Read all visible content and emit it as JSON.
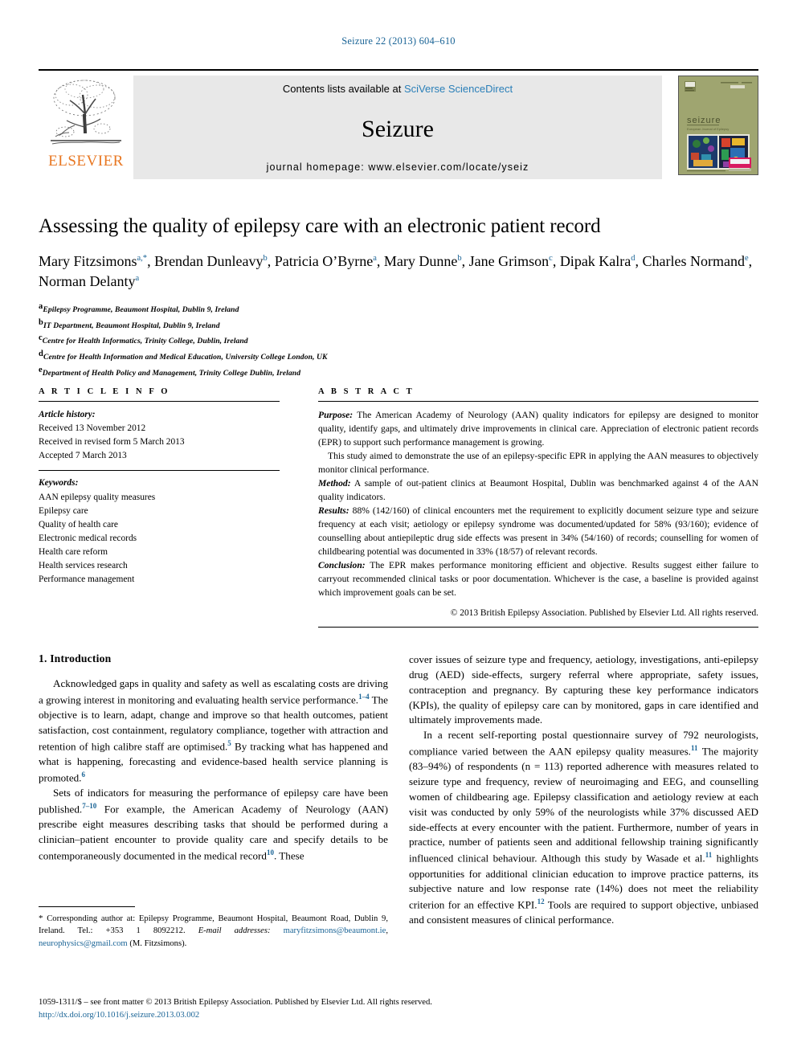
{
  "running_head": "Seizure 22 (2013) 604–610",
  "masthead": {
    "publisher_logo_name": "elsevier-tree-logo",
    "publisher_wordmark": "ELSEVIER",
    "contents_prefix": "Contents lists available at ",
    "contents_link": "SciVerse ScienceDirect",
    "journal_title": "Seizure",
    "homepage": "journal homepage: www.elsevier.com/locate/yseiz",
    "cover_alt": "journal-cover-thumbnail"
  },
  "article": {
    "title": "Assessing the quality of epilepsy care with an electronic patient record",
    "authors": [
      {
        "name": "Mary Fitzsimons",
        "marks": "a,*"
      },
      {
        "name": "Brendan Dunleavy",
        "marks": "b"
      },
      {
        "name": "Patricia O’Byrne",
        "marks": "a"
      },
      {
        "name": "Mary Dunne",
        "marks": "b"
      },
      {
        "name": "Jane Grimson",
        "marks": "c"
      },
      {
        "name": "Dipak Kalra",
        "marks": "d"
      },
      {
        "name": "Charles Normand",
        "marks": "e"
      },
      {
        "name": "Norman Delanty",
        "marks": "a"
      }
    ],
    "affiliations": [
      {
        "mark": "a",
        "text": "Epilepsy Programme, Beaumont Hospital, Dublin 9, Ireland"
      },
      {
        "mark": "b",
        "text": "IT Department, Beaumont Hospital, Dublin 9, Ireland"
      },
      {
        "mark": "c",
        "text": "Centre for Health Informatics, Trinity College, Dublin, Ireland"
      },
      {
        "mark": "d",
        "text": "Centre for Health Information and Medical Education, University College London, UK"
      },
      {
        "mark": "e",
        "text": "Department of Health Policy and Management, Trinity College Dublin, Ireland"
      }
    ]
  },
  "article_info": {
    "heading": "A R T I C L E   I N F O",
    "history_label": "Article history:",
    "history": [
      "Received 13 November 2012",
      "Received in revised form 5 March 2013",
      "Accepted 7 March 2013"
    ],
    "keywords_label": "Keywords:",
    "keywords": [
      "AAN epilepsy quality measures",
      "Epilepsy care",
      "Quality of health care",
      "Electronic medical records",
      "Health care reform",
      "Health services research",
      "Performance management"
    ]
  },
  "abstract": {
    "heading": "A B S T R A C T",
    "purpose_label": "Purpose:",
    "purpose_text": " The American Academy of Neurology (AAN) quality indicators for epilepsy are designed to monitor quality, identify gaps, and ultimately drive improvements in clinical care. Appreciation of electronic patient records (EPR) to support such performance management is growing.",
    "purpose_second": "This study aimed to demonstrate the use of an epilepsy-specific EPR in applying the AAN measures to objectively monitor clinical performance.",
    "method_label": "Method:",
    "method_text": " A sample of out-patient clinics at Beaumont Hospital, Dublin was benchmarked against 4 of the AAN quality indicators.",
    "results_label": "Results:",
    "results_text": " 88% (142/160) of clinical encounters met the requirement to explicitly document seizure type and seizure frequency at each visit; aetiology or epilepsy syndrome was documented/updated for 58% (93/160); evidence of counselling about antiepileptic drug side effects was present in 34% (54/160) of records; counselling for women of childbearing potential was documented in 33% (18/57) of relevant records.",
    "conclusion_label": "Conclusion:",
    "conclusion_text": " The EPR makes performance monitoring efficient and objective. Results suggest either failure to carryout recommended clinical tasks or poor documentation. Whichever is the case, a baseline is provided against which improvement goals can be set.",
    "copyright": "© 2013 British Epilepsy Association. Published by Elsevier Ltd. All rights reserved."
  },
  "body": {
    "section_heading": "1. Introduction",
    "left_p1_a": "Acknowledged gaps in quality and safety as well as escalating costs are driving a growing interest in monitoring and evaluating health service performance.",
    "left_p1_ref1": "1–4",
    "left_p1_b": " The objective is to learn, adapt, change and improve so that health outcomes, patient satisfaction, cost containment, regulatory compliance, together with attraction and retention of high calibre staff are optimised.",
    "left_p1_ref2": "5",
    "left_p1_c": " By tracking what has happened and what is happening, forecasting and evidence-based health service planning is promoted.",
    "left_p1_ref3": "6",
    "left_p2_a": "Sets of indicators for measuring the performance of epilepsy care have been published.",
    "left_p2_ref1": "7–10",
    "left_p2_b": " For example, the American Academy of Neurology (AAN) prescribe eight measures describing tasks that should be performed during a clinician–patient encounter to provide quality care and specify details to be contemporaneously documented in the medical record",
    "left_p2_ref2": "10",
    "left_p2_c": ". These",
    "right_p1": "cover issues of seizure type and frequency, aetiology, investigations, anti-epilepsy drug (AED) side-effects, surgery referral where appropriate, safety issues, contraception and pregnancy. By capturing these key performance indicators (KPIs), the quality of epilepsy care can by monitored, gaps in care identified and ultimately improvements made.",
    "right_p2_a": "In a recent self-reporting postal questionnaire survey of 792 neurologists, compliance varied between the AAN epilepsy quality measures.",
    "right_p2_ref1": "11",
    "right_p2_b": " The majority (83–94%) of respondents (n = 113) reported adherence with measures related to seizure type and frequency, review of neuroimaging and EEG, and counselling women of childbearing age. Epilepsy classification and aetiology review at each visit was conducted by only 59% of the neurologists while 37% discussed AED side-effects at every encounter with the patient. Furthermore, number of years in practice, number of patients seen and additional fellowship training significantly influenced clinical behaviour. Although this study by Wasade et al.",
    "right_p2_ref2": "11",
    "right_p2_c": " highlights opportunities for additional clinician education to improve practice patterns, its subjective nature and low response rate (14%) does not meet the reliability criterion for an effective KPI.",
    "right_p2_ref3": "12",
    "right_p2_d": " Tools are required to support objective, unbiased and consistent measures of clinical performance."
  },
  "footnote": {
    "star": "*",
    "corresponding": " Corresponding author at: Epilepsy Programme, Beaumont Hospital, Beaumont Road, Dublin 9, Ireland. Tel.: +353 1 8092212.",
    "email_label": "E-mail addresses:",
    "email1": "maryfitzsimons@beaumont.ie",
    "email_sep": ", ",
    "email2": "neurophysics@gmail.com",
    "email_suffix": "(M. Fitzsimons)."
  },
  "page_footer": {
    "issn_line": "1059-1311/$ – see front matter © 2013 British Epilepsy Association. Published by Elsevier Ltd. All rights reserved.",
    "doi": "http://dx.doi.org/10.1016/j.seizure.2013.03.002"
  },
  "colors": {
    "link": "#1a6496",
    "sciencedirect_link": "#2a7fb8",
    "elsevier_orange": "#e87722",
    "masthead_bg": "#e8e8e8",
    "cover_bg": "#9aa06a"
  }
}
